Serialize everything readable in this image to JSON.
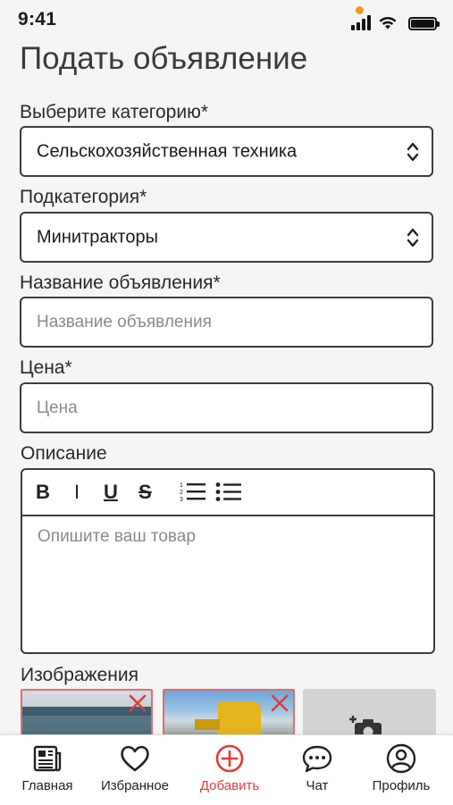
{
  "status_bar": {
    "time": "9:41",
    "icons": [
      "signal-icon",
      "wifi-icon",
      "battery-icon"
    ],
    "dot_color": "#f29a1f"
  },
  "page": {
    "title": "Подать объявление"
  },
  "form": {
    "category": {
      "label": "Выберите категорию*",
      "value": "Сельскохозяйственная техника"
    },
    "subcategory": {
      "label": "Подкатегория*",
      "value": "Минитракторы"
    },
    "ad_title": {
      "label": "Название объявления*",
      "placeholder": "Название объявления",
      "value": ""
    },
    "price": {
      "label": "Цена*",
      "placeholder": "Цена",
      "value": ""
    },
    "description": {
      "label": "Описание",
      "placeholder": "Опишите ваш товар",
      "toolbar": {
        "bold": "B",
        "italic": "I",
        "underline": "U",
        "strike": "S"
      }
    },
    "images": {
      "label": "Изображения",
      "thumbnails": [
        "building-photo",
        "loader-photo"
      ],
      "remove_color": "#e5393b"
    }
  },
  "bottom_nav": {
    "active_color": "#e5393b",
    "items": [
      {
        "label": "Главная",
        "icon": "newspaper-icon"
      },
      {
        "label": "Избранное",
        "icon": "heart-icon"
      },
      {
        "label": "Добавить",
        "icon": "plus-circle-icon",
        "active": true
      },
      {
        "label": "Чат",
        "icon": "chat-bubble-icon"
      },
      {
        "label": "Профиль",
        "icon": "user-circle-icon"
      }
    ]
  }
}
